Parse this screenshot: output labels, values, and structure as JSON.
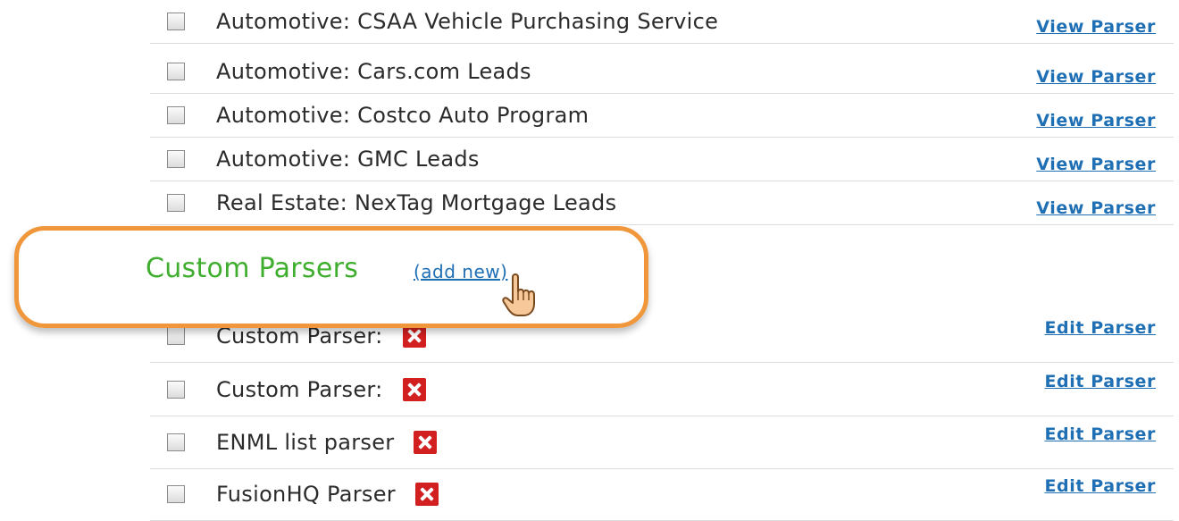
{
  "builtin_parsers": [
    {
      "name": "Automotive: CSAA Vehicle Purchasing Service",
      "action": "View Parser"
    },
    {
      "name": "Automotive: Cars.com Leads",
      "action": "View Parser"
    },
    {
      "name": "Automotive: Costco Auto Program",
      "action": "View Parser"
    },
    {
      "name": "Automotive: GMC Leads",
      "action": "View Parser"
    },
    {
      "name": "Real Estate: NexTag Mortgage Leads",
      "action": "View Parser"
    }
  ],
  "custom_section": {
    "title": "Custom Parsers",
    "add_new": "(add new)"
  },
  "custom_parsers": [
    {
      "name": "Custom Parser:",
      "action": "Edit Parser"
    },
    {
      "name": "Custom Parser:",
      "action": "Edit Parser"
    },
    {
      "name": "ENML list parser",
      "action": "Edit Parser"
    },
    {
      "name": "FusionHQ Parser",
      "action": "Edit Parser"
    }
  ],
  "colors": {
    "section_title": "#3fae2f",
    "link": "#1f6fb5",
    "highlight": "#f0973b",
    "delete": "#d21f1f"
  },
  "icons": [
    "checkbox",
    "delete-x-icon",
    "hand-pointer-cursor-icon"
  ]
}
